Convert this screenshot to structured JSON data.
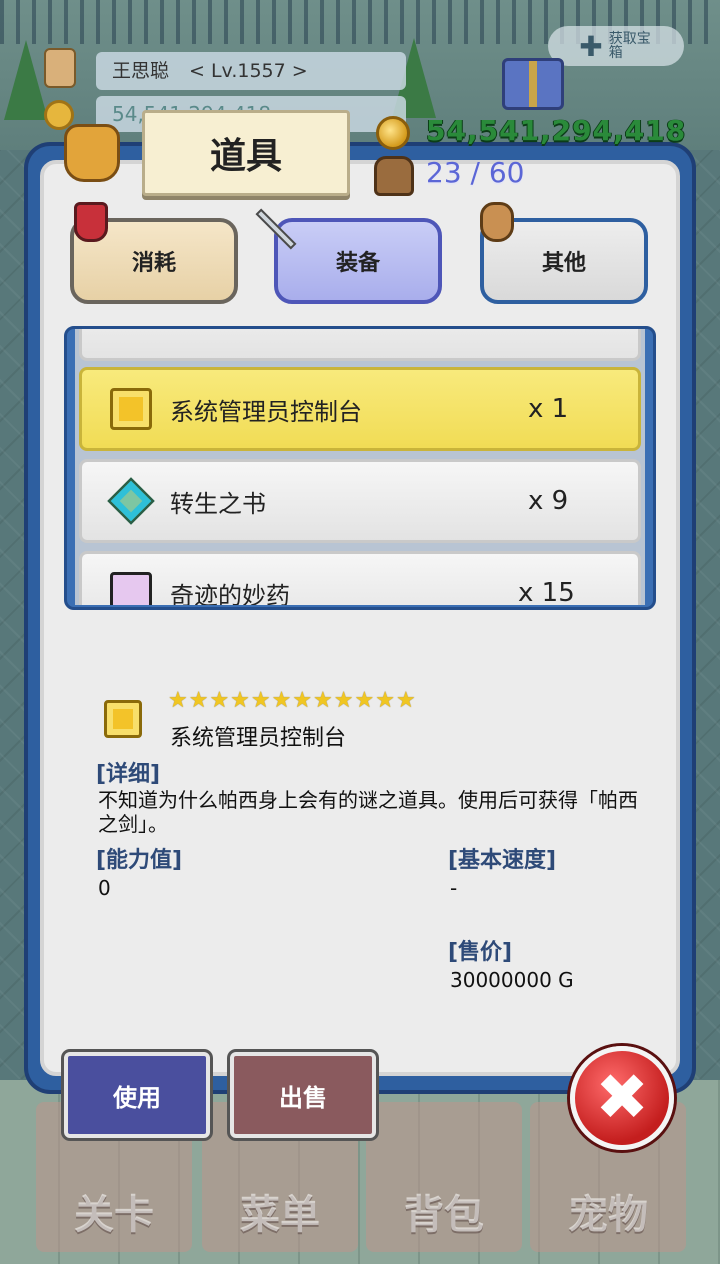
{
  "player": {
    "name": "王思聪",
    "level": "< Lv.1557 >",
    "gold_behind": "54,541,294,418"
  },
  "share": {
    "label": "获取宝箱"
  },
  "panel": {
    "title": "道具",
    "gold": "54,541,294,418",
    "capacity": "23 / 60"
  },
  "tabs": [
    {
      "label": "消耗"
    },
    {
      "label": "装备"
    },
    {
      "label": "其他"
    }
  ],
  "items": [
    {
      "name": "系统管理员控制台",
      "qty": "x 1",
      "icon": "treasure-box-icon"
    },
    {
      "name": "转生之书",
      "qty": "x 9",
      "icon": "book-icon"
    },
    {
      "name": "奇迹的妙药",
      "qty": "x 15",
      "icon": "flask-icon"
    }
  ],
  "detail": {
    "stars": "★★★★★★★★★★★★",
    "name": "系统管理员控制台",
    "detail_label": "[详细]",
    "description": "不知道为什么帕西身上会有的谜之道具。使用后可获得「帕西之剑」。",
    "ability_label": "[能力值]",
    "ability_value": "0",
    "speed_label": "[基本速度]",
    "speed_value": "-",
    "price_label": "[售价]",
    "price_value": "30000000 G"
  },
  "buttons": {
    "use": "使用",
    "sell": "出售",
    "close": "✖"
  },
  "nav": [
    {
      "label": "关卡"
    },
    {
      "label": "菜单"
    },
    {
      "label": "背包"
    },
    {
      "label": "宠物"
    }
  ],
  "colors": {
    "gold_text": "#2a8a3a",
    "capacity_text": "#5b66d6",
    "selected_row": "#f1dc55",
    "panel_border": "#2e5fa0"
  }
}
